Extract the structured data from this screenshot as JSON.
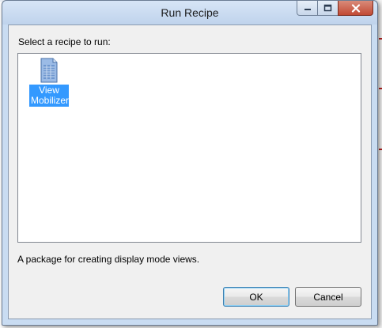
{
  "window": {
    "title": "Run Recipe",
    "controls": [
      "minimize-icon",
      "maximize-icon",
      "close-icon"
    ]
  },
  "dialog": {
    "prompt": "Select a recipe to run:",
    "recipes": [
      {
        "label": "View Mobilizer",
        "icon": "document-icon",
        "selected": true
      }
    ],
    "description": "A package for creating display mode views.",
    "buttons": {
      "ok": "OK",
      "cancel": "Cancel"
    }
  },
  "colors": {
    "selection": "#3399ff",
    "close_button": "#c24a34",
    "frame": "#c9dcf2"
  }
}
